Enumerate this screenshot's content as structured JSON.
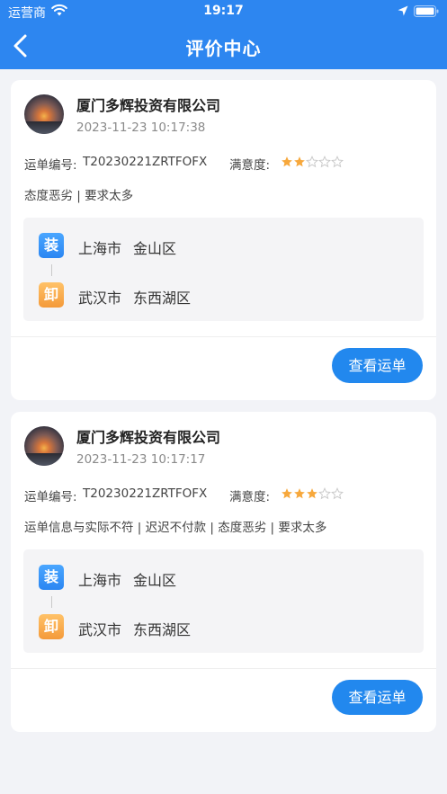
{
  "status_bar": {
    "carrier": "运营商",
    "time": "19:17"
  },
  "header": {
    "title": "评价中心"
  },
  "labels": {
    "order_no": "运单编号:",
    "satisfaction": "满意度:",
    "view_button": "查看运单",
    "load_badge": "装",
    "unload_badge": "卸"
  },
  "reviews": [
    {
      "company": "厦门多辉投资有限公司",
      "time": "2023-11-23 10:17:38",
      "order_no": "T20230221ZRTFOFX",
      "rating": 2,
      "rating_max": 5,
      "tags": "态度恶劣 | 要求太多",
      "load": {
        "city": "上海市",
        "district": "金山区"
      },
      "unload": {
        "city": "武汉市",
        "district": "东西湖区"
      }
    },
    {
      "company": "厦门多辉投资有限公司",
      "time": "2023-11-23 10:17:17",
      "order_no": "T20230221ZRTFOFX",
      "rating": 3,
      "rating_max": 5,
      "tags": "运单信息与实际不符 | 迟迟不付款 | 态度恶劣 | 要求太多",
      "load": {
        "city": "上海市",
        "district": "金山区"
      },
      "unload": {
        "city": "武汉市",
        "district": "东西湖区"
      }
    }
  ],
  "colors": {
    "header": "#2d86f0",
    "button": "#2288ee",
    "star_filled": "#f7a83c",
    "star_empty": "#c8c8c8",
    "load_badge": "#3a98f8",
    "unload_badge": "#f7ab4c"
  },
  "icons": {
    "back": "chevron-left-icon",
    "wifi": "wifi-icon",
    "location": "location-arrow-icon",
    "battery": "battery-icon",
    "star": "star-icon"
  }
}
